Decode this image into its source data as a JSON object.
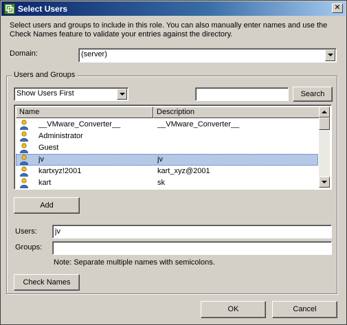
{
  "window": {
    "title": "Select Users",
    "close_glyph": "✕"
  },
  "intro": "Select users and groups to include in this role. You can also manually enter names and use the Check Names feature to validate your entries against the directory.",
  "domain": {
    "label": "Domain:",
    "value": "(server)"
  },
  "users_groups": {
    "title": "Users and Groups",
    "filter": {
      "value": "Show Users First"
    },
    "search": {
      "value": "",
      "button_label": "Search"
    },
    "columns": [
      "Name",
      "Description"
    ],
    "rows": [
      {
        "name": "__VMware_Converter__",
        "description": "__VMware_Converter__",
        "selected": false
      },
      {
        "name": "Administrator",
        "description": "",
        "selected": false
      },
      {
        "name": "Guest",
        "description": "",
        "selected": false
      },
      {
        "name": "jv",
        "description": "jv",
        "selected": true
      },
      {
        "name": "kartxyz!2001",
        "description": "kart_xyz@2001",
        "selected": false
      },
      {
        "name": "kart",
        "description": "sk",
        "selected": false
      }
    ],
    "add_label": "Add"
  },
  "users": {
    "label": "Users:",
    "value": "jv"
  },
  "groups": {
    "label": "Groups:",
    "value": ""
  },
  "note": "Note: Separate multiple names with semicolons.",
  "check_names_label": "Check Names",
  "ok_label": "OK",
  "cancel_label": "Cancel",
  "colors": {
    "selection": "#b6c8e6",
    "titlebar": "#0a246a",
    "user_icon": "#f0c020"
  }
}
